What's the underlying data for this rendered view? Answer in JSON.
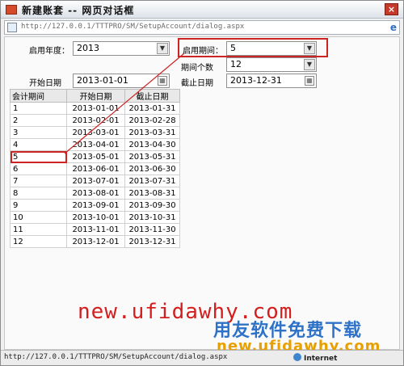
{
  "window": {
    "title": "新建账套 -- 网页对话框",
    "address": "http://127.0.0.1/TTTPRO/SM/SetupAccount/dialog.aspx",
    "close_glyph": "×"
  },
  "form": {
    "start_year_label": "启用年度：",
    "start_year_value": "2013",
    "start_period_label": "启用期间：",
    "start_period_value": "5",
    "period_count_label": "期间个数",
    "period_count_value": "12",
    "start_date_label": "开始日期",
    "start_date_value": "2013-01-01",
    "end_date_label": "截止日期",
    "end_date_value": "2013-12-31"
  },
  "table": {
    "headers": [
      "会计期间",
      "开始日期",
      "截止日期"
    ],
    "rows": [
      [
        "1",
        "2013-01-01",
        "2013-01-31"
      ],
      [
        "2",
        "2013-02-01",
        "2013-02-28"
      ],
      [
        "3",
        "2013-03-01",
        "2013-03-31"
      ],
      [
        "4",
        "2013-04-01",
        "2013-04-30"
      ],
      [
        "5",
        "2013-05-01",
        "2013-05-31"
      ],
      [
        "6",
        "2013-06-01",
        "2013-06-30"
      ],
      [
        "7",
        "2013-07-01",
        "2013-07-31"
      ],
      [
        "8",
        "2013-08-01",
        "2013-08-31"
      ],
      [
        "9",
        "2013-09-01",
        "2013-09-30"
      ],
      [
        "10",
        "2013-10-01",
        "2013-10-31"
      ],
      [
        "11",
        "2013-11-01",
        "2013-11-30"
      ],
      [
        "12",
        "2013-12-01",
        "2013-12-31"
      ]
    ],
    "highlighted_period": "5"
  },
  "watermark": {
    "line1": "new.ufidawhy.com",
    "line2": "用友软件免费下载",
    "line3": "new.ufidawhy.com"
  },
  "statusbar": {
    "url": "http://127.0.0.1/TTTPRO/SM/SetupAccount/dialog.aspx",
    "zone": "Internet"
  },
  "colors": {
    "highlight": "#cc2323",
    "watermark_red": "#d41e1e",
    "watermark_blue": "#2e72c8",
    "watermark_orange": "#e8a000"
  },
  "icons": {
    "dropdown": "chevron-down-icon",
    "calendar": "calendar-icon",
    "page": "page-icon",
    "browser": "ie-icon",
    "zone": "globe-icon"
  }
}
